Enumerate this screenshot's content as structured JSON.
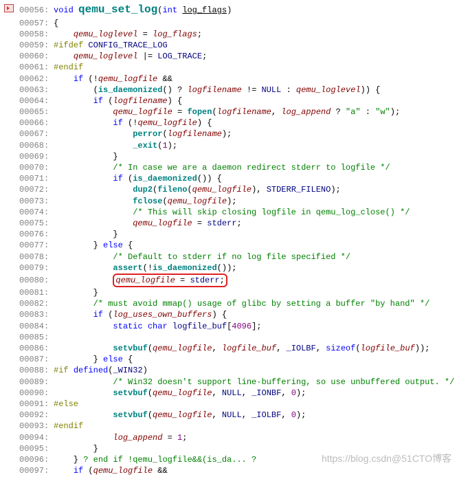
{
  "file": {
    "function_name": "qemu_set_log",
    "return_type": "void",
    "param_type": "int",
    "param_name": "log_flags"
  },
  "watermark": "https://blog.csdn@51CTO博客",
  "gutter_icon": "breakpoint-marker",
  "lines": [
    {
      "n": "00056:",
      "seg": [
        [
          "kw",
          "void "
        ],
        [
          "fnbig",
          "qemu_set_log"
        ],
        [
          "op",
          "("
        ],
        [
          "kw",
          "int "
        ],
        [
          "param",
          "log_flags"
        ],
        [
          "op",
          ")"
        ]
      ]
    },
    {
      "n": "00057:",
      "seg": [
        [
          "op",
          "{"
        ]
      ]
    },
    {
      "n": "00058:",
      "seg": [
        [
          "op",
          "    "
        ],
        [
          "var",
          "qemu_loglevel"
        ],
        [
          "op",
          " = "
        ],
        [
          "var",
          "log_flags"
        ],
        [
          "op",
          ";"
        ]
      ]
    },
    {
      "n": "00059:",
      "seg": [
        [
          "pp",
          "#ifdef "
        ],
        [
          "id",
          "CONFIG_TRACE_LOG"
        ]
      ]
    },
    {
      "n": "00060:",
      "seg": [
        [
          "op",
          "    "
        ],
        [
          "var",
          "qemu_loglevel"
        ],
        [
          "op",
          " |= "
        ],
        [
          "id",
          "LOG_TRACE"
        ],
        [
          "op",
          ";"
        ]
      ]
    },
    {
      "n": "00061:",
      "seg": [
        [
          "pp",
          "#endif"
        ]
      ]
    },
    {
      "n": "00062:",
      "seg": [
        [
          "op",
          "    "
        ],
        [
          "kw",
          "if"
        ],
        [
          "op",
          " (!"
        ],
        [
          "var",
          "qemu_logfile"
        ],
        [
          "op",
          " &&"
        ]
      ]
    },
    {
      "n": "00063:",
      "seg": [
        [
          "op",
          "        ("
        ],
        [
          "fn",
          "is_daemonized"
        ],
        [
          "op",
          "() ? "
        ],
        [
          "var",
          "logfilename"
        ],
        [
          "op",
          " != "
        ],
        [
          "id",
          "NULL"
        ],
        [
          "op",
          " : "
        ],
        [
          "var",
          "qemu_loglevel"
        ],
        [
          "op",
          ")) {"
        ]
      ]
    },
    {
      "n": "00064:",
      "seg": [
        [
          "op",
          "        "
        ],
        [
          "kw",
          "if"
        ],
        [
          "op",
          " ("
        ],
        [
          "var",
          "logfilename"
        ],
        [
          "op",
          ") {"
        ]
      ]
    },
    {
      "n": "00065:",
      "seg": [
        [
          "op",
          "            "
        ],
        [
          "var",
          "qemu_logfile"
        ],
        [
          "op",
          " = "
        ],
        [
          "fn",
          "fopen"
        ],
        [
          "op",
          "("
        ],
        [
          "var",
          "logfilename"
        ],
        [
          "op",
          ", "
        ],
        [
          "var",
          "log_append"
        ],
        [
          "op",
          " ? "
        ],
        [
          "str",
          "\"a\""
        ],
        [
          "op",
          " : "
        ],
        [
          "str",
          "\"w\""
        ],
        [
          "op",
          ");"
        ]
      ]
    },
    {
      "n": "00066:",
      "seg": [
        [
          "op",
          "            "
        ],
        [
          "kw",
          "if"
        ],
        [
          "op",
          " (!"
        ],
        [
          "var",
          "qemu_logfile"
        ],
        [
          "op",
          ") {"
        ]
      ]
    },
    {
      "n": "00067:",
      "seg": [
        [
          "op",
          "                "
        ],
        [
          "fn",
          "perror"
        ],
        [
          "op",
          "("
        ],
        [
          "var",
          "logfilename"
        ],
        [
          "op",
          ");"
        ]
      ]
    },
    {
      "n": "00068:",
      "seg": [
        [
          "op",
          "                "
        ],
        [
          "fn",
          "_exit"
        ],
        [
          "op",
          "("
        ],
        [
          "num",
          "1"
        ],
        [
          "op",
          ");"
        ]
      ]
    },
    {
      "n": "00069:",
      "seg": [
        [
          "op",
          "            }"
        ]
      ]
    },
    {
      "n": "00070:",
      "seg": [
        [
          "op",
          "            "
        ],
        [
          "cm",
          "/* In case we are a daemon redirect stderr to logfile */"
        ]
      ]
    },
    {
      "n": "00071:",
      "seg": [
        [
          "op",
          "            "
        ],
        [
          "kw",
          "if"
        ],
        [
          "op",
          " ("
        ],
        [
          "fn",
          "is_daemonized"
        ],
        [
          "op",
          "()) {"
        ]
      ]
    },
    {
      "n": "00072:",
      "seg": [
        [
          "op",
          "                "
        ],
        [
          "fn",
          "dup2"
        ],
        [
          "op",
          "("
        ],
        [
          "fn",
          "fileno"
        ],
        [
          "op",
          "("
        ],
        [
          "var",
          "qemu_logfile"
        ],
        [
          "op",
          "), "
        ],
        [
          "id",
          "STDERR_FILENO"
        ],
        [
          "op",
          ");"
        ]
      ]
    },
    {
      "n": "00073:",
      "seg": [
        [
          "op",
          "                "
        ],
        [
          "fn",
          "fclose"
        ],
        [
          "op",
          "("
        ],
        [
          "var",
          "qemu_logfile"
        ],
        [
          "op",
          ");"
        ]
      ]
    },
    {
      "n": "00074:",
      "seg": [
        [
          "op",
          "                "
        ],
        [
          "cm",
          "/* This will skip closing logfile in qemu_log_close() */"
        ]
      ]
    },
    {
      "n": "00075:",
      "seg": [
        [
          "op",
          "                "
        ],
        [
          "var",
          "qemu_logfile"
        ],
        [
          "op",
          " = "
        ],
        [
          "id",
          "stderr"
        ],
        [
          "op",
          ";"
        ]
      ]
    },
    {
      "n": "00076:",
      "seg": [
        [
          "op",
          "            }"
        ]
      ]
    },
    {
      "n": "00077:",
      "seg": [
        [
          "op",
          "        } "
        ],
        [
          "kw",
          "else"
        ],
        [
          "op",
          " {"
        ]
      ]
    },
    {
      "n": "00078:",
      "seg": [
        [
          "op",
          "            "
        ],
        [
          "cm",
          "/* Default to stderr if no log file specified */"
        ]
      ]
    },
    {
      "n": "00079:",
      "seg": [
        [
          "op",
          "            "
        ],
        [
          "fn",
          "assert"
        ],
        [
          "op",
          "(!"
        ],
        [
          "fn",
          "is_daemonized"
        ],
        [
          "op",
          "());"
        ]
      ]
    },
    {
      "n": "00080:",
      "hl": true,
      "seg": [
        [
          "op",
          "            "
        ],
        [
          "var",
          "qemu_logfile"
        ],
        [
          "op",
          " = "
        ],
        [
          "id",
          "stderr"
        ],
        [
          "op",
          ";"
        ]
      ]
    },
    {
      "n": "00081:",
      "seg": [
        [
          "op",
          "        }"
        ]
      ]
    },
    {
      "n": "00082:",
      "seg": [
        [
          "op",
          "        "
        ],
        [
          "cm",
          "/* must avoid mmap() usage of glibc by setting a buffer \"by hand\" */"
        ]
      ]
    },
    {
      "n": "00083:",
      "seg": [
        [
          "op",
          "        "
        ],
        [
          "kw",
          "if"
        ],
        [
          "op",
          " ("
        ],
        [
          "var",
          "log_uses_own_buffers"
        ],
        [
          "op",
          ") {"
        ]
      ]
    },
    {
      "n": "00084:",
      "seg": [
        [
          "op",
          "            "
        ],
        [
          "kw",
          "static"
        ],
        [
          "op",
          " "
        ],
        [
          "kw",
          "char"
        ],
        [
          "op",
          " "
        ],
        [
          "id",
          "logfile_buf"
        ],
        [
          "op",
          "["
        ],
        [
          "num",
          "4096"
        ],
        [
          "op",
          "];"
        ]
      ]
    },
    {
      "n": "00085:",
      "seg": []
    },
    {
      "n": "00086:",
      "seg": [
        [
          "op",
          "            "
        ],
        [
          "fn",
          "setvbuf"
        ],
        [
          "op",
          "("
        ],
        [
          "var",
          "qemu_logfile"
        ],
        [
          "op",
          ", "
        ],
        [
          "var",
          "logfile_buf"
        ],
        [
          "op",
          ", "
        ],
        [
          "id",
          "_IOLBF"
        ],
        [
          "op",
          ", "
        ],
        [
          "kw",
          "sizeof"
        ],
        [
          "op",
          "("
        ],
        [
          "var",
          "logfile_buf"
        ],
        [
          "op",
          "));"
        ]
      ]
    },
    {
      "n": "00087:",
      "seg": [
        [
          "op",
          "        } "
        ],
        [
          "kw",
          "else"
        ],
        [
          "op",
          " {"
        ]
      ]
    },
    {
      "n": "00088:",
      "seg": [
        [
          "pp",
          "#if "
        ],
        [
          "kw",
          "defined"
        ],
        [
          "op",
          "("
        ],
        [
          "id",
          "_WIN32"
        ],
        [
          "op",
          ")"
        ]
      ]
    },
    {
      "n": "00089:",
      "seg": [
        [
          "op",
          "            "
        ],
        [
          "cm",
          "/* Win32 doesn't support line-buffering, so use unbuffered output. */"
        ]
      ]
    },
    {
      "n": "00090:",
      "seg": [
        [
          "op",
          "            "
        ],
        [
          "fn",
          "setvbuf"
        ],
        [
          "op",
          "("
        ],
        [
          "var",
          "qemu_logfile"
        ],
        [
          "op",
          ", "
        ],
        [
          "id",
          "NULL"
        ],
        [
          "op",
          ", "
        ],
        [
          "id",
          "_IONBF"
        ],
        [
          "op",
          ", "
        ],
        [
          "num",
          "0"
        ],
        [
          "op",
          ");"
        ]
      ]
    },
    {
      "n": "00091:",
      "seg": [
        [
          "pp",
          "#else"
        ]
      ]
    },
    {
      "n": "00092:",
      "seg": [
        [
          "op",
          "            "
        ],
        [
          "fn",
          "setvbuf"
        ],
        [
          "op",
          "("
        ],
        [
          "var",
          "qemu_logfile"
        ],
        [
          "op",
          ", "
        ],
        [
          "id",
          "NULL"
        ],
        [
          "op",
          ", "
        ],
        [
          "id",
          "_IOLBF"
        ],
        [
          "op",
          ", "
        ],
        [
          "num",
          "0"
        ],
        [
          "op",
          ");"
        ]
      ]
    },
    {
      "n": "00093:",
      "seg": [
        [
          "pp",
          "#endif"
        ]
      ]
    },
    {
      "n": "00094:",
      "seg": [
        [
          "op",
          "            "
        ],
        [
          "var",
          "log_append"
        ],
        [
          "op",
          " = "
        ],
        [
          "num",
          "1"
        ],
        [
          "op",
          ";"
        ]
      ]
    },
    {
      "n": "00095:",
      "seg": [
        [
          "op",
          "        }"
        ]
      ]
    },
    {
      "n": "00096:",
      "seg": [
        [
          "op",
          "    } "
        ],
        [
          "cm",
          "? end if !qemu_logfile&&(is_da... ?"
        ]
      ]
    },
    {
      "n": "00097:",
      "seg": [
        [
          "op",
          "    "
        ],
        [
          "kw",
          "if"
        ],
        [
          "op",
          " ("
        ],
        [
          "var",
          "qemu_logfile"
        ],
        [
          "op",
          " &&"
        ]
      ]
    }
  ]
}
